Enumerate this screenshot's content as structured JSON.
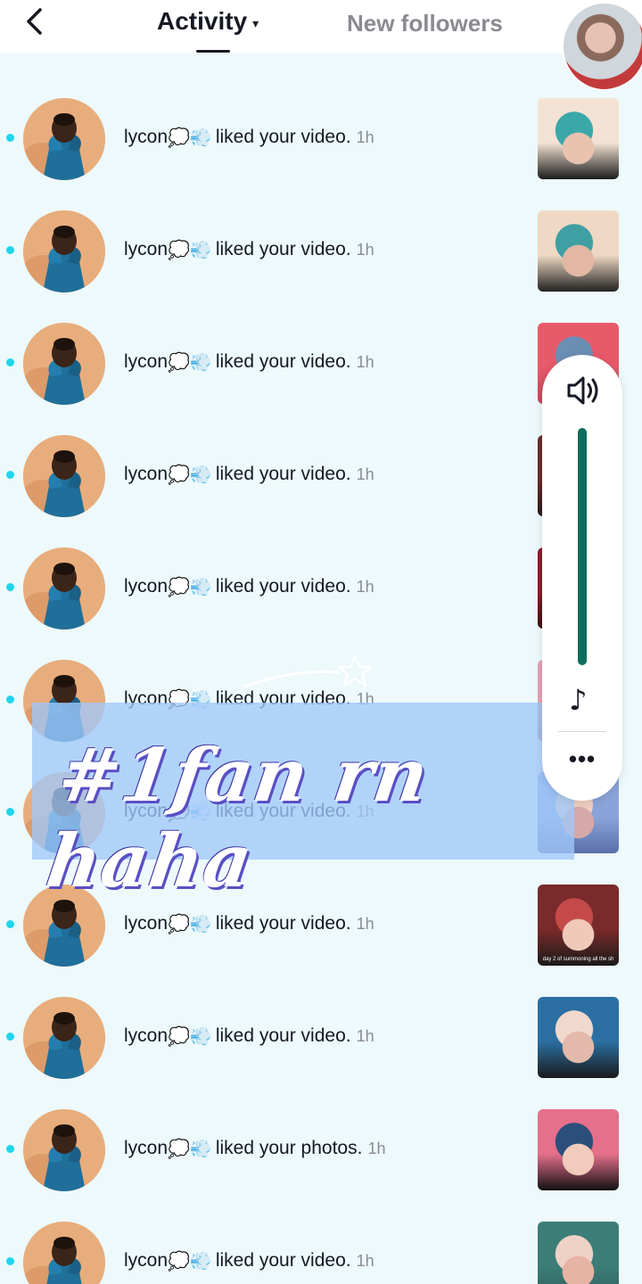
{
  "header": {
    "tab_activity": "Activity",
    "tab_activity_caret": "▾",
    "tab_new_followers": "New followers"
  },
  "notifications": [
    {
      "username": "lycon",
      "emoji": "💭💨",
      "action": "liked your video.",
      "time": "1h"
    },
    {
      "username": "lycon",
      "emoji": "💭💨",
      "action": "liked your video.",
      "time": "1h"
    },
    {
      "username": "lycon",
      "emoji": "💭💨",
      "action": "liked your video.",
      "time": "1h"
    },
    {
      "username": "lycon",
      "emoji": "💭💨",
      "action": "liked your video.",
      "time": "1h"
    },
    {
      "username": "lycon",
      "emoji": "💭💨",
      "action": "liked your video.",
      "time": "1h"
    },
    {
      "username": "lycon",
      "emoji": "💭💨",
      "action": "liked your video.",
      "time": "1h"
    },
    {
      "username": "lycon",
      "emoji": "💭💨",
      "action": "liked your video.",
      "time": "1h"
    },
    {
      "username": "lycon",
      "emoji": "💭💨",
      "action": "liked your video.",
      "time": "1h",
      "thumb_caption": "day 2 of summoning all the sh"
    },
    {
      "username": "lycon",
      "emoji": "💭💨",
      "action": "liked your video.",
      "time": "1h"
    },
    {
      "username": "lycon",
      "emoji": "💭💨",
      "action": "liked your photos.",
      "time": "1h"
    },
    {
      "username": "lycon",
      "emoji": "💭💨",
      "action": "liked your video.",
      "time": "1h"
    }
  ],
  "overlay": {
    "sticker_text": "#1fan rn haha"
  },
  "volume_panel": {
    "level": 1.0,
    "music_glyph": "♪",
    "more_glyph": "•••"
  },
  "colors": {
    "background": "#edf9fb",
    "unread_dot": "#20d5ec",
    "volume_fill": "#0e6e5e",
    "sticker_bg": "#a0c8fa"
  },
  "icons": [
    "back-arrow-icon",
    "caret-down-icon",
    "speaker-icon",
    "music-note-icon",
    "more-dots-icon",
    "star-doodle-icon"
  ]
}
